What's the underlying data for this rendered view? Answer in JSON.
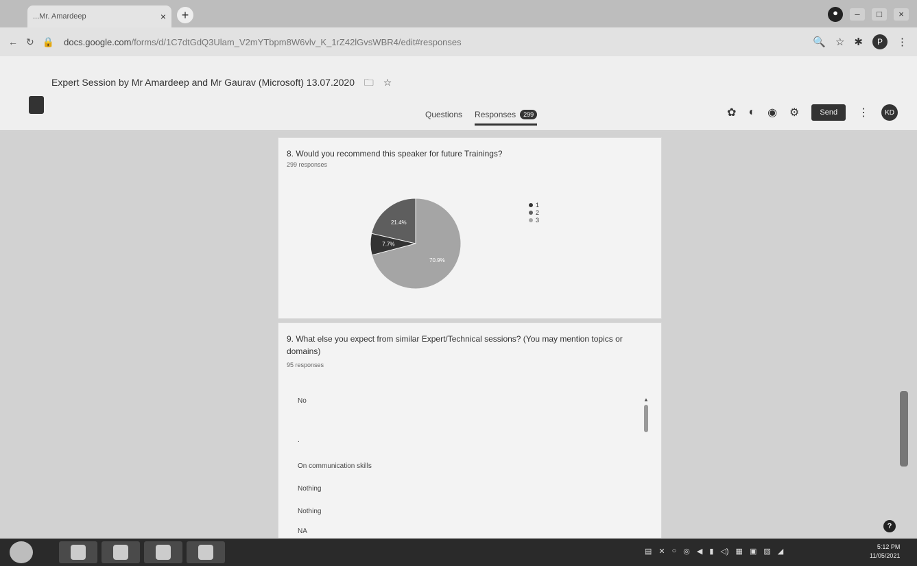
{
  "browser": {
    "tab_title": "...Mr. Amardeep",
    "tab_close": "×",
    "new_tab": "+",
    "url_host": "docs.google.com",
    "url_path": "/forms/d/1C7dtGdQ3Ulam_V2mYTbpm8W6vlv_K_1rZ42lGvsWBR4/edit#responses",
    "profile_initial": "P"
  },
  "form": {
    "title": "Expert Session by Mr Amardeep and Mr Gaurav (Microsoft)  13.07.2020",
    "tabs": {
      "questions": "Questions",
      "responses": "Responses",
      "responses_count": "299"
    },
    "send_label": "Send",
    "avatar_initials": "KD"
  },
  "question8": {
    "text": "8. Would you recommend this speaker for future Trainings?",
    "responses": "299 responses",
    "legend": [
      {
        "label": "1",
        "color": "#333333"
      },
      {
        "label": "2",
        "color": "#5e5e5e"
      },
      {
        "label": "3",
        "color": "#a5a5a5"
      }
    ],
    "slice_labels": [
      "70.9%",
      "21.4%",
      "7.7%"
    ]
  },
  "chart_data": {
    "type": "pie",
    "categories": [
      "1",
      "2",
      "3"
    ],
    "values": [
      7.7,
      21.4,
      70.9
    ],
    "title": "",
    "legend": "right"
  },
  "question9": {
    "text": "9. What else you expect from similar Expert/Technical sessions? (You may mention topics or domains)",
    "responses": "95 responses",
    "answers": [
      "No",
      ".",
      "On communication skills",
      "Nothing",
      "Nothing",
      "NA"
    ]
  },
  "taskbar": {
    "time": "5:12 PM",
    "date": "11/05/2021"
  }
}
